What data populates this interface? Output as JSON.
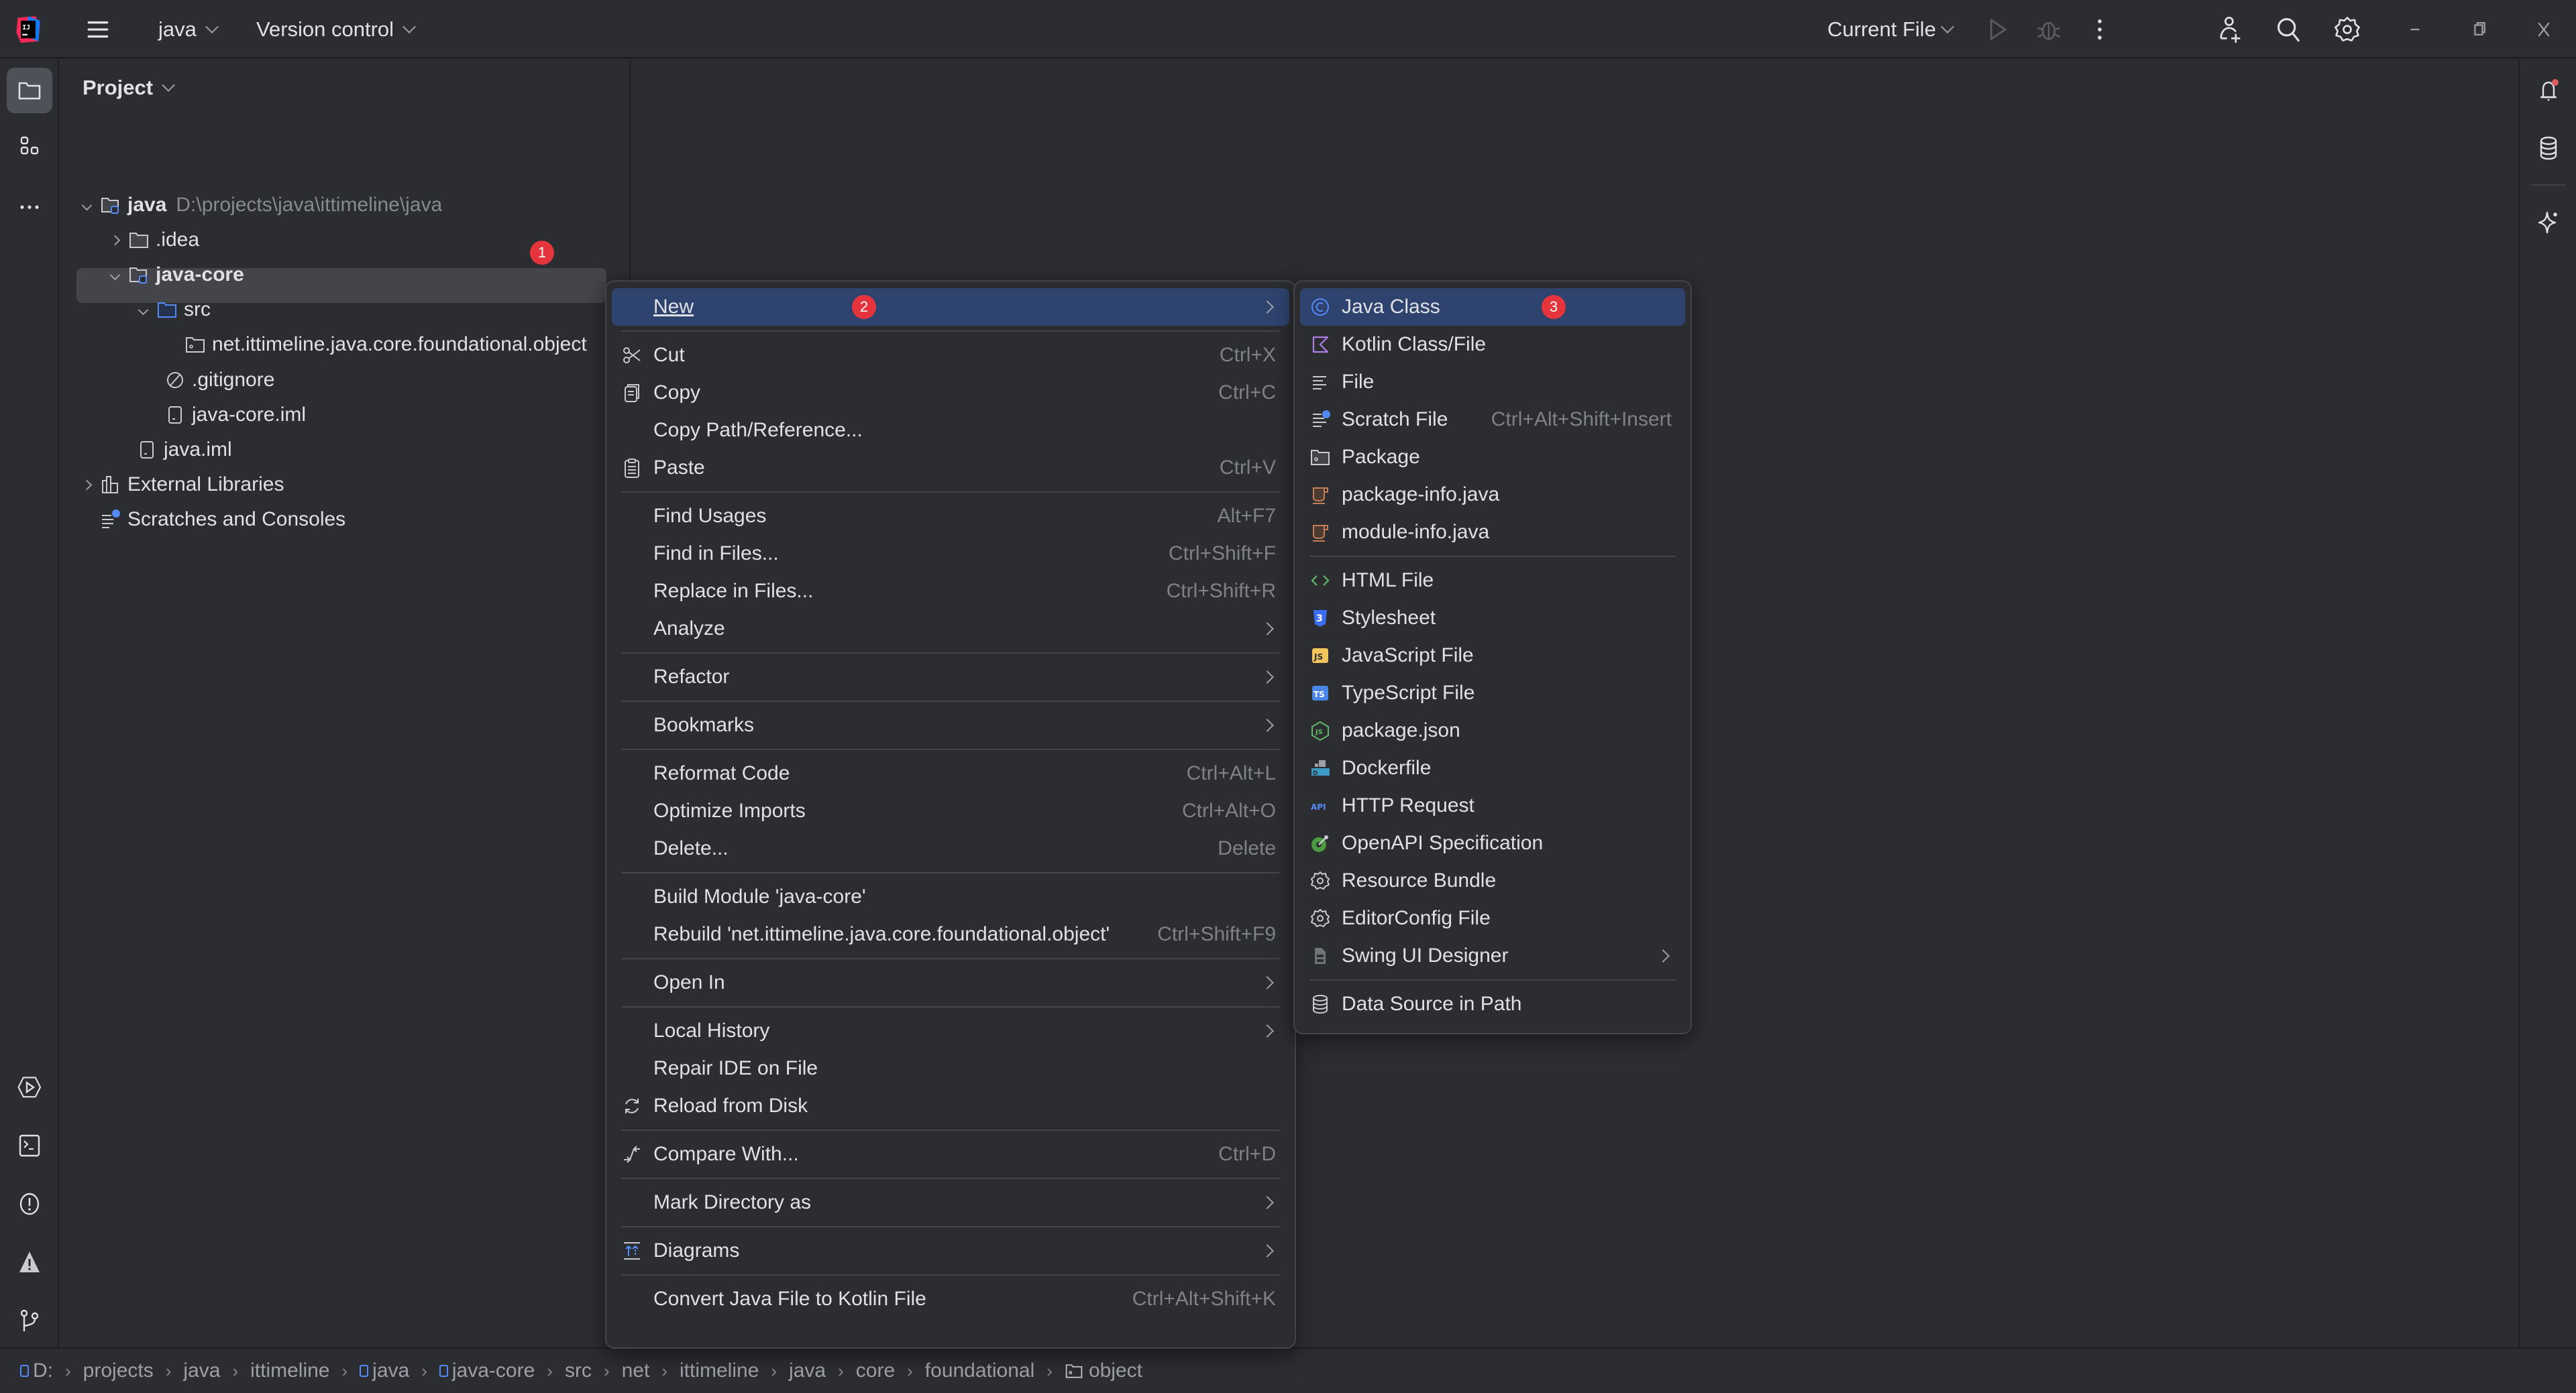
{
  "titlebar": {
    "project_name": "java",
    "vcs_label": "Version control",
    "run_config": "Current File",
    "icons": [
      "app-logo-icon",
      "main-menu-icon",
      "run-icon",
      "debug-icon",
      "more-actions-icon",
      "add-user-icon",
      "search-icon",
      "settings-icon",
      "minimize-icon",
      "restore-icon",
      "close-icon"
    ]
  },
  "left_toolbar": {
    "top": [
      "project-tool-icon",
      "structure-icon",
      "more-tools-icon"
    ],
    "bottom": [
      "services-icon",
      "terminal-icon",
      "problems-icon",
      "warnings-icon",
      "git-icon"
    ]
  },
  "right_toolbar": [
    "notifications-icon",
    "database-icon",
    "ai-assistant-icon"
  ],
  "project_panel": {
    "title": "Project",
    "tree": [
      {
        "label": "java",
        "path": "D:\\projects\\java\\ittimeline\\java",
        "expanded": true,
        "bold": true,
        "type": "module"
      },
      {
        "label": ".idea",
        "expanded": false,
        "type": "folder"
      },
      {
        "label": "java-core",
        "expanded": true,
        "bold": true,
        "type": "module"
      },
      {
        "label": "src",
        "expanded": true,
        "type": "source-folder"
      },
      {
        "label": "net.ittimeline.java.core.foundational.object",
        "type": "package",
        "selected": true
      },
      {
        "label": ".gitignore",
        "type": "ignore-file"
      },
      {
        "label": "java-core.iml",
        "type": "iml-file"
      },
      {
        "label": "java.iml",
        "type": "iml-file"
      },
      {
        "label": "External Libraries",
        "expanded": false,
        "type": "libraries"
      },
      {
        "label": "Scratches and Consoles",
        "type": "scratches"
      }
    ]
  },
  "badges": {
    "one": "1",
    "two": "2",
    "three": "3"
  },
  "context_menu": {
    "items": [
      {
        "label": "New",
        "shortcut": "",
        "submenu": true,
        "highlighted": true
      },
      {
        "label": "Cut",
        "shortcut": "Ctrl+X",
        "icon": "scissors-icon"
      },
      {
        "label": "Copy",
        "shortcut": "Ctrl+C",
        "icon": "copy-icon"
      },
      {
        "label": "Copy Path/Reference...",
        "shortcut": ""
      },
      {
        "label": "Paste",
        "shortcut": "Ctrl+V",
        "icon": "paste-icon"
      },
      {
        "label": "Find Usages",
        "shortcut": "Alt+F7"
      },
      {
        "label": "Find in Files...",
        "shortcut": "Ctrl+Shift+F"
      },
      {
        "label": "Replace in Files...",
        "shortcut": "Ctrl+Shift+R"
      },
      {
        "label": "Analyze",
        "submenu": true
      },
      {
        "label": "Refactor",
        "submenu": true
      },
      {
        "label": "Bookmarks",
        "submenu": true
      },
      {
        "label": "Reformat Code",
        "shortcut": "Ctrl+Alt+L"
      },
      {
        "label": "Optimize Imports",
        "shortcut": "Ctrl+Alt+O"
      },
      {
        "label": "Delete...",
        "shortcut": "Delete"
      },
      {
        "label": "Build Module 'java-core'",
        "shortcut": ""
      },
      {
        "label": "Rebuild 'net.ittimeline.java.core.foundational.object'",
        "shortcut": "Ctrl+Shift+F9"
      },
      {
        "label": "Open In",
        "submenu": true
      },
      {
        "label": "Local History",
        "submenu": true
      },
      {
        "label": "Repair IDE on File",
        "shortcut": ""
      },
      {
        "label": "Reload from Disk",
        "shortcut": "",
        "icon": "reload-icon"
      },
      {
        "label": "Compare With...",
        "shortcut": "Ctrl+D",
        "icon": "compare-icon"
      },
      {
        "label": "Mark Directory as",
        "submenu": true
      },
      {
        "label": "Diagrams",
        "submenu": true,
        "icon": "diagrams-icon"
      },
      {
        "label": "Convert Java File to Kotlin File",
        "shortcut": "Ctrl+Alt+Shift+K"
      }
    ]
  },
  "new_submenu": {
    "items": [
      {
        "label": "Java Class",
        "highlighted": true,
        "icon": "java-class-icon"
      },
      {
        "label": "Kotlin Class/File",
        "icon": "kotlin-icon"
      },
      {
        "label": "File",
        "icon": "file-icon"
      },
      {
        "label": "Scratch File",
        "shortcut": "Ctrl+Alt+Shift+Insert",
        "icon": "scratch-file-icon"
      },
      {
        "label": "Package",
        "icon": "package-icon"
      },
      {
        "label": "package-info.java",
        "icon": "java-file-icon"
      },
      {
        "label": "module-info.java",
        "icon": "java-file-icon"
      },
      {
        "label": "HTML File",
        "icon": "html-icon"
      },
      {
        "label": "Stylesheet",
        "icon": "css-icon"
      },
      {
        "label": "JavaScript File",
        "icon": "javascript-icon"
      },
      {
        "label": "TypeScript File",
        "icon": "typescript-icon"
      },
      {
        "label": "package.json",
        "icon": "nodejs-icon"
      },
      {
        "label": "Dockerfile",
        "icon": "docker-icon"
      },
      {
        "label": "HTTP Request",
        "icon": "api-icon"
      },
      {
        "label": "OpenAPI Specification",
        "icon": "openapi-icon"
      },
      {
        "label": "Resource Bundle",
        "icon": "gear-icon"
      },
      {
        "label": "EditorConfig File",
        "icon": "gear-icon"
      },
      {
        "label": "Swing UI Designer",
        "submenu": true,
        "icon": "swing-designer-icon"
      },
      {
        "label": "Data Source in Path",
        "icon": "database-icon"
      }
    ]
  },
  "statusbar": {
    "breadcrumbs": [
      "D:",
      "projects",
      "java",
      "ittimeline",
      "java",
      "java-core",
      "src",
      "net",
      "ittimeline",
      "java",
      "core",
      "foundational",
      "object"
    ]
  },
  "colors": {
    "background": "#2b2d30",
    "selection": "#2e436e",
    "badge": "#e5343c",
    "accent_blue": "#548af7"
  }
}
